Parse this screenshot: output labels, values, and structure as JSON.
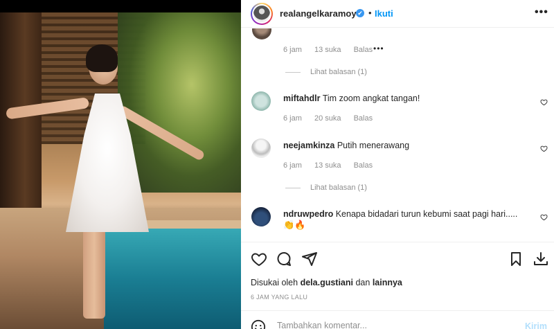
{
  "header": {
    "username": "realangelkaramoy",
    "verified_mark": "✔",
    "dot": "•",
    "follow_label": "Ikuti",
    "more_label": "•••"
  },
  "comments": [
    {
      "id": "c0",
      "username": "",
      "text": "",
      "time": "6 jam",
      "likes": "13 suka",
      "reply_label": "Balas",
      "more": "•••",
      "view_replies": "Lihat balasan (1)"
    },
    {
      "id": "c1",
      "username": "miftahdlr",
      "text": "Tim zoom angkat tangan!",
      "time": "6 jam",
      "likes": "20 suka",
      "reply_label": "Balas"
    },
    {
      "id": "c2",
      "username": "neejamkinza",
      "text": "Putih menerawang",
      "time": "6 jam",
      "likes": "13 suka",
      "reply_label": "Balas",
      "view_replies": "Lihat balasan (1)"
    },
    {
      "id": "c3",
      "username": "ndruwpedro",
      "text": "Kenapa bidadari turun kebumi saat pagi hari.....",
      "emoji": "👏🔥"
    }
  ],
  "actions": {
    "like_icon": "heart-icon",
    "comment_icon": "comment-icon",
    "share_icon": "share-icon",
    "save_icon": "bookmark-icon",
    "download_icon": "download-icon"
  },
  "likes": {
    "prefix": "Disukai oleh",
    "user": "dela.gustiani",
    "joiner": "dan",
    "others": "lainnya"
  },
  "time_ago": "6 JAM YANG LALU",
  "add_comment": {
    "placeholder": "Tambahkan komentar...",
    "post_label": "Kirim"
  },
  "colors": {
    "accent": "#0095f6",
    "verified": "#3897f0",
    "muted": "#8e8e8e",
    "text": "#262626"
  }
}
